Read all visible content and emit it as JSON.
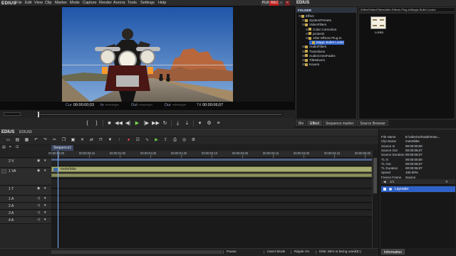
{
  "app": {
    "name": "EDIUS",
    "menus": [
      "File",
      "Edit",
      "View",
      "Clip",
      "Marker",
      "Mode",
      "Capture",
      "Render",
      "Aurora",
      "Tools",
      "Settings",
      "Help"
    ],
    "mode_plr": "PLR",
    "mode_rec": "REC"
  },
  "player": {
    "timecodes": {
      "cur_label": "Cur",
      "cur_value": "00:00:00;03",
      "in_label": "In",
      "in_value": "--:--:--;--",
      "out_label": "Out",
      "out_value": "--:--:--;--",
      "dur_label": "Dur",
      "dur_value": "--:--:--;--",
      "ttl_label": "Ttl",
      "ttl_value": "00:00:06;07"
    }
  },
  "bin": {
    "title": "EDIUS",
    "folder_header": "FOLDER",
    "path": "\\Effect\\VideoFilters\\After Effects Plug-in\\Magic Bullet Looks\\",
    "tree": [
      {
        "label": "Effect",
        "depth": 0
      },
      {
        "label": "SystemPresets",
        "depth": 1
      },
      {
        "label": "VideoFilters",
        "depth": 1
      },
      {
        "label": "Color Correction",
        "depth": 2
      },
      {
        "label": "proDAD",
        "depth": 2
      },
      {
        "label": "After Effects Plug-in",
        "depth": 2
      },
      {
        "label": "Magic Bullet Looks",
        "depth": 3,
        "selected": true
      },
      {
        "label": "AudioFilters",
        "depth": 1
      },
      {
        "label": "Transitions",
        "depth": 1
      },
      {
        "label": "AudioCrossFades",
        "depth": 1
      },
      {
        "label": "TitleMixers",
        "depth": 1
      },
      {
        "label": "Keyers",
        "depth": 1
      }
    ],
    "items": [
      {
        "label": "Looks"
      }
    ],
    "tabs": [
      "Bin",
      "Effect",
      "Sequence marker",
      "Source Browser"
    ],
    "active_tab": "Effect"
  },
  "timeline": {
    "title": "EDIUS",
    "project": "EDIUS5",
    "sequence_tab": "Sequence1",
    "ruler": [
      "00:00:00;00",
      "00:00:00;15",
      "00:00:01;00",
      "00:00:01;05",
      "00:00:01;20",
      "00:00:02;10",
      "00:00:03;00",
      "00:00:03;15",
      "00:00:04;00",
      "00:00:04;15",
      "00:00:05;00"
    ],
    "tracks": [
      {
        "name": "2 V"
      },
      {
        "name": "1 VA"
      },
      {
        "name": "1 T"
      },
      {
        "name": "1 A"
      },
      {
        "name": "2 A"
      },
      {
        "name": "3 A"
      },
      {
        "name": "4 A"
      }
    ],
    "clip_name": "motorbike",
    "status": {
      "pause": "Pause",
      "insert": "Insert Mode",
      "ripple": "Ripple On",
      "disk": "Disk: 85% is being used(E:)"
    }
  },
  "info": {
    "rows": [
      {
        "k": "File Name",
        "v": "E:\\video\\schrade\\moto..."
      },
      {
        "k": "Clip Name",
        "v": "motorbike"
      },
      {
        "k": "Source In",
        "v": "00:00:00;00"
      },
      {
        "k": "Source Out",
        "v": "00:00:06;07"
      },
      {
        "k": "Source Duration",
        "v": "00:00:06;07"
      },
      {
        "k": "TL In",
        "v": "00:00:00;00"
      },
      {
        "k": "TL Out",
        "v": "00:00:06;07"
      },
      {
        "k": "TL Duration",
        "v": "00:00:06;07"
      },
      {
        "k": "Speed",
        "v": "100.00%"
      },
      {
        "k": "Freeze Frame",
        "v": "Source"
      }
    ],
    "layer_page": "1/1",
    "layer_name": "Layouter",
    "tab": "Information"
  },
  "colors": {
    "accent": "#2f62c9",
    "clip": "#a6ab6f",
    "play": "#7bdc4e",
    "record": "#ff4040"
  }
}
